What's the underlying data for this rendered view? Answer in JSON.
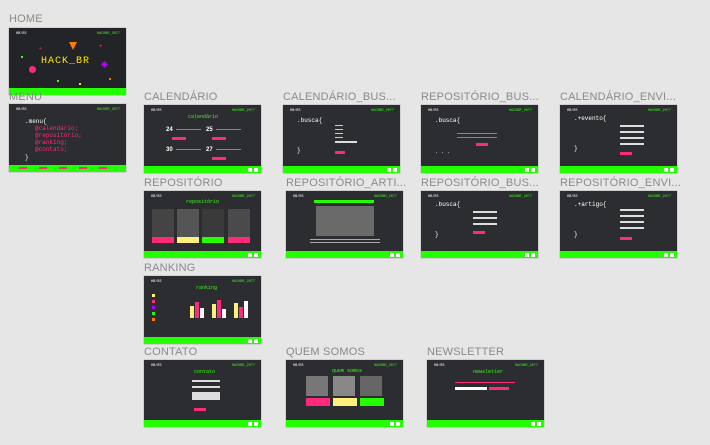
{
  "frames": {
    "home": {
      "label": "HOME",
      "title": "HACK_BR",
      "logo": "HB/RS",
      "brand": "HACKBR_2077"
    },
    "menu": {
      "label": "MENU",
      "code_open": ".menu{",
      "items": [
        "@calendário;",
        "@repositório;",
        "@ranking;",
        "@contato;"
      ],
      "code_close": "}"
    },
    "calendario": {
      "label": "CALENDÁRIO",
      "heading": "calendário"
    },
    "calendario_busca": {
      "label": "CALENDÁRIO_BUS...",
      "code": ".busca{",
      "close": "}"
    },
    "repositorio_busca_cal": {
      "label": "REPOSITÓRIO_BUS...",
      "code": ".busca{",
      "close": "}"
    },
    "calendario_envio": {
      "label": "CALENDÁRIO_ENVI...",
      "code": ".+evento{",
      "close": "}"
    },
    "repositorio": {
      "label": "REPOSITÓRIO",
      "heading": "repositório"
    },
    "repositorio_artigo": {
      "label": "REPOSITÓRIO_ARTI..."
    },
    "repositorio_busca": {
      "label": "REPOSITÓRIO_BUS...",
      "code": ".busca{",
      "close": "}"
    },
    "repositorio_envio": {
      "label": "REPOSITÓRIO_ENVI...",
      "code": ".+artigo{",
      "close": "}"
    },
    "ranking": {
      "label": "RANKING",
      "heading": "ranking"
    },
    "contato": {
      "label": "CONTATO",
      "heading": "contato"
    },
    "quem_somos": {
      "label": "QUEM SOMOS",
      "heading": "quem somos"
    },
    "newsletter": {
      "label": "NEWSLETTER",
      "heading": "newsletter"
    }
  },
  "colors": {
    "canvas": "#e6e6e6",
    "frame": "#2b2d30",
    "accent": "#24ff00",
    "pink": "#ff2a7a",
    "yellow": "#fff07a"
  }
}
